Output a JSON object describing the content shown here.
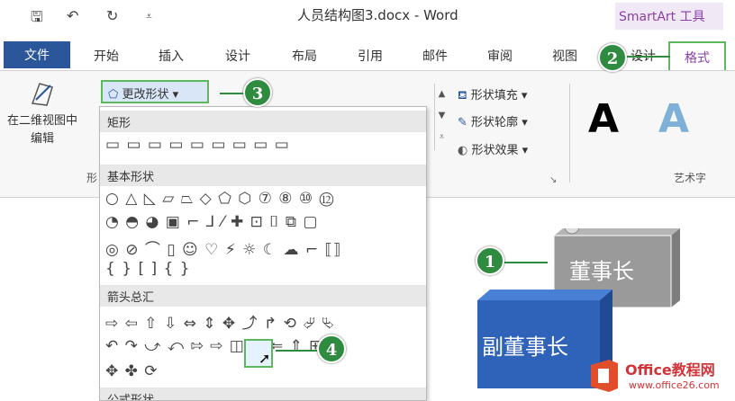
{
  "titlebar": {
    "title": "人员结构图3.docx - Word",
    "smartart_tab": "SmartArt 工具",
    "save_icon": "save-icon",
    "undo_icon": "undo-icon",
    "redo_icon": "redo-icon",
    "customize_icon": "customize-icon"
  },
  "ribbon_tabs": {
    "file": "文件",
    "home": "开始",
    "insert": "插入",
    "design": "设计",
    "layout": "布局",
    "references": "引用",
    "mailings": "邮件",
    "review": "审阅",
    "view": "视图",
    "smartart_design": "设计",
    "format": "格式"
  },
  "ribbon": {
    "edit_2d_line1": "在二维视图中",
    "edit_2d_line2": "编辑",
    "group_label_shapes": "形",
    "change_shape": "更改形状",
    "shape_fill": "形状填充",
    "shape_outline": "形状轮廓",
    "shape_effects": "形状效果",
    "wordart_label": "艺术字",
    "wordart_a1": "A",
    "wordart_a2": "A"
  },
  "dropdown": {
    "categories": [
      {
        "label": "矩形",
        "rows": [
          "▭ ▭ ▭ ▭ ▭ ▭ ▭ ▭ ▭"
        ]
      },
      {
        "label": "基本形状",
        "rows": [
          "○ △ ◺ ▱ ⏢ ◇ ⬠ ⬡ ⑦ ⑧ ⑩ ⑫",
          "◔ ◓ ◕ ▣ ⌐ ⅃ ⁄ ✚ ⊡ ⌷ ⧉ ▢",
          "◎ ⊘ ⌒ ▯ ☺ ♡ ⚡ ☼ ☾ ☁ ⌐ ⟦⟧",
          "{ } [ ] { }"
        ]
      },
      {
        "label": "箭头总汇",
        "rows": [
          "⇨ ⇦ ⇧ ⇩ ⇔ ⇕ ✥ ⤴ ↱ ⟲ ⮰ ⮱",
          "↶ ↷ ⤻ ⤺ ⇰ ⇨ ◫ ⇒ ⇐ ⇑ ⊞ ⊟",
          "✥ ✤ ⟳"
        ]
      },
      {
        "label": "公式形状",
        "rows": []
      }
    ]
  },
  "callouts": [
    "1",
    "2",
    "3",
    "4"
  ],
  "org_chart": {
    "chairman": "董事长",
    "vice_chairman": "副董事长"
  },
  "logo": {
    "name": "Office教程网",
    "url": "www.office26.com"
  },
  "colors": {
    "word_blue": "#2b579a",
    "callout_green": "#2e8b3f",
    "highlight_green": "#5bb85d",
    "smartart_purple": "#8a3fa8",
    "box_gray": "#9a9a9a",
    "box_blue": "#2f62b9"
  }
}
